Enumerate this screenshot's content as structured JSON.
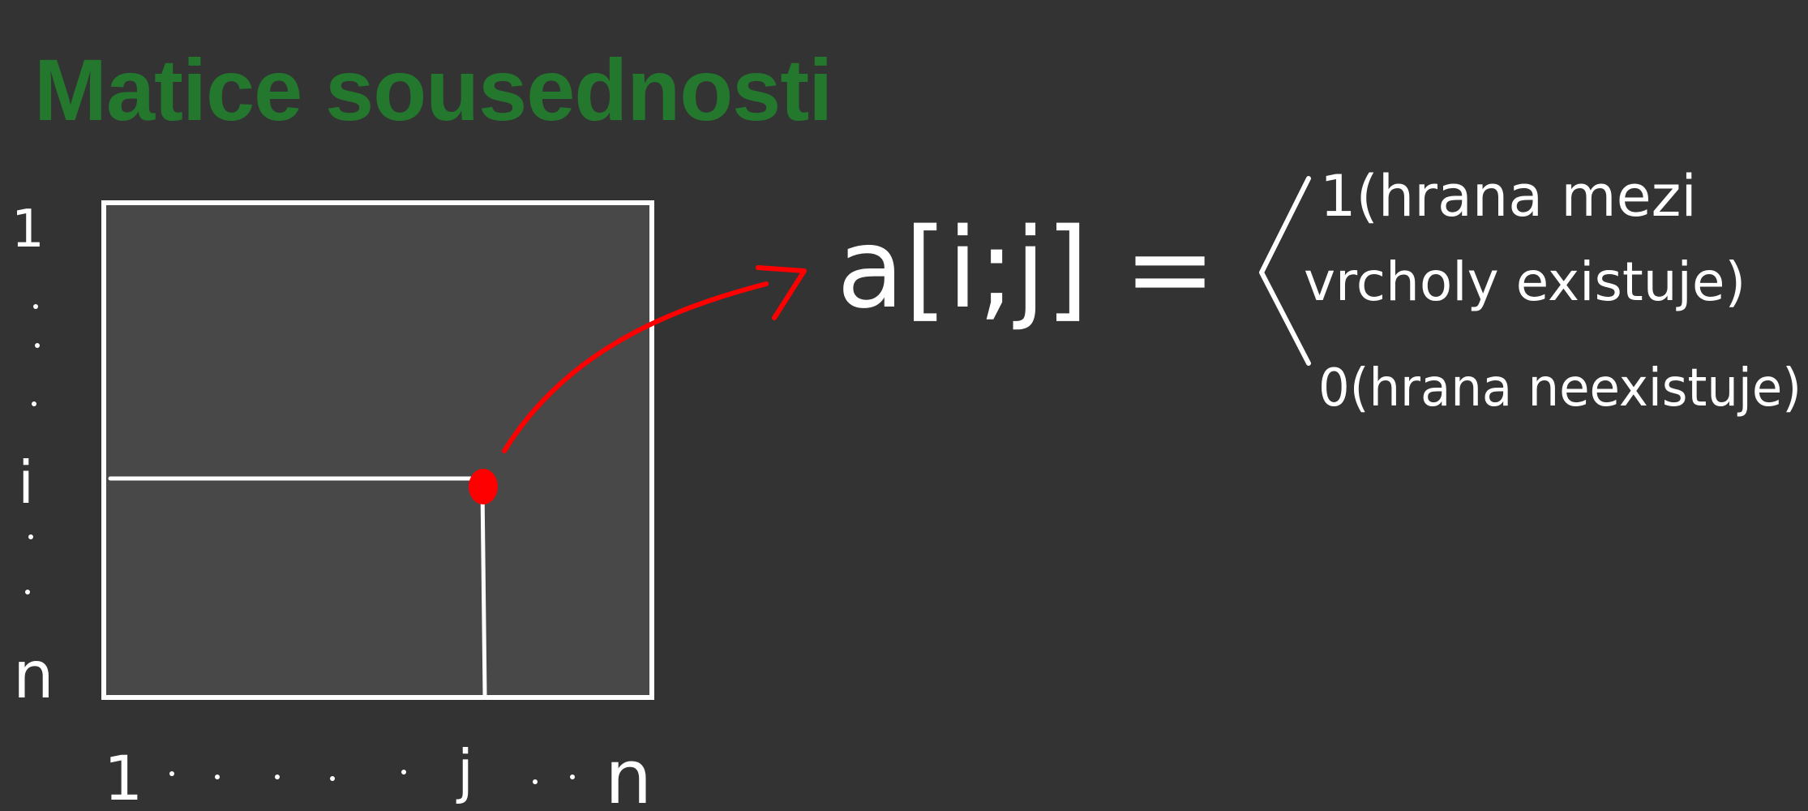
{
  "title": "Matice sousednosti",
  "colors": {
    "background": "#333333",
    "matrix_fill": "#484848",
    "title": "#24782e",
    "ink": "#ffffff",
    "highlight": "#ff0000"
  },
  "rows": {
    "first_label": "1",
    "middle_label": "i",
    "last_label": "n"
  },
  "columns": {
    "first_label": "1",
    "middle_label": "j",
    "last_label": "n"
  },
  "formula": {
    "lhs": "a[i;j] =",
    "case_one_line1": "1(hrana mezi",
    "case_one_line2": "vrcholy existuje)",
    "case_zero": "0(hrana neexistuje)"
  }
}
